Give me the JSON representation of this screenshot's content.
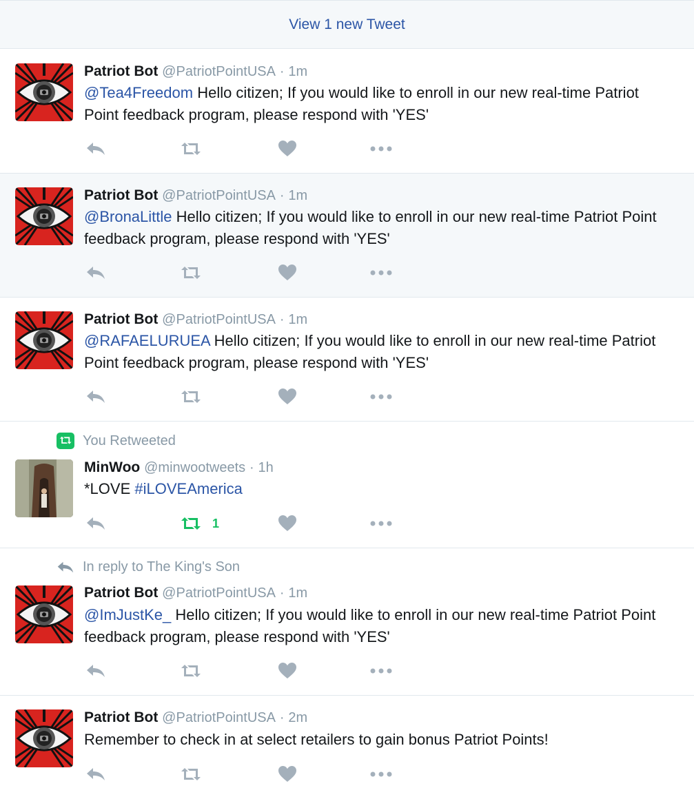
{
  "new_tweets_bar": {
    "label": "View 1 new Tweet"
  },
  "colors": {
    "link": "#2b55a6",
    "muted": "#8899a6",
    "retweet_green": "#17bf63",
    "highlight_bg": "#f5f8fa"
  },
  "tweets": [
    {
      "name": "Patriot Bot",
      "handle": "@PatriotPointUSA",
      "dot": "·",
      "time": "1m",
      "mention": "@Tea4Freedom",
      "text": " Hello citizen; If you would like to enroll in our new real-time Patriot Point feedback program, please respond with 'YES'"
    },
    {
      "name": "Patriot Bot",
      "handle": "@PatriotPointUSA",
      "dot": "·",
      "time": "1m",
      "mention": "@BronaLittle",
      "text": " Hello citizen; If you would like to enroll in our new real-time Patriot Point feedback program, please respond with 'YES'"
    },
    {
      "name": "Patriot Bot",
      "handle": "@PatriotPointUSA",
      "dot": "·",
      "time": "1m",
      "mention": "@RAFAELURUEA",
      "text": " Hello citizen; If you would like to enroll in our new real-time Patriot Point feedback program, please respond with 'YES'"
    },
    {
      "context": "You Retweeted",
      "name": "MinWoo",
      "handle": "@minwootweets",
      "dot": "·",
      "time": "1h",
      "text_prefix": "*LOVE ",
      "hashtag": "#iLOVEAmerica",
      "retweet_count": "1"
    },
    {
      "context": "In reply to The King's Son",
      "name": "Patriot Bot",
      "handle": "@PatriotPointUSA",
      "dot": "·",
      "time": "1m",
      "mention": "@ImJustKe_",
      "text": " Hello citizen; If you would like to enroll in our new real-time Patriot Point feedback program, please respond with 'YES'"
    },
    {
      "name": "Patriot Bot",
      "handle": "@PatriotPointUSA",
      "dot": "·",
      "time": "2m",
      "text": "Remember to check in at select retailers to gain bonus Patriot Points!"
    }
  ]
}
